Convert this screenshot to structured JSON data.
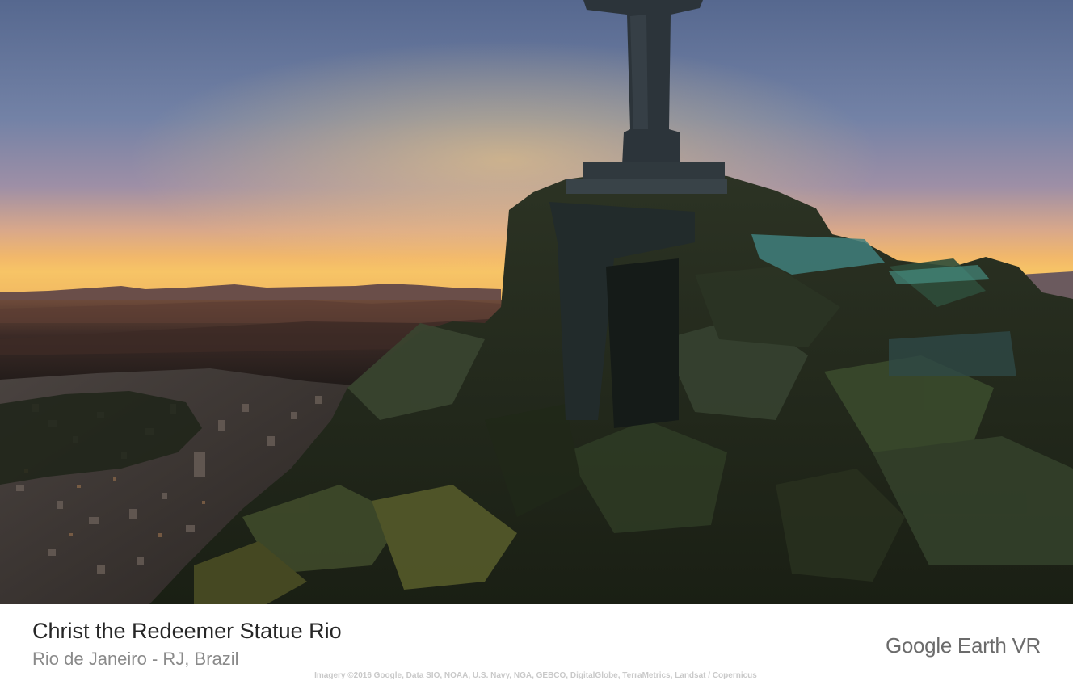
{
  "scene": {
    "image_subject": "christ-the-redeemer-summit",
    "sky_colors": [
      "#5a6e96",
      "#8a86a6",
      "#c9a3a3",
      "#e8b479",
      "#f6c569"
    ]
  },
  "location": {
    "title": "Christ the Redeemer Statue Rio",
    "subtitle": "Rio de Janeiro - RJ, Brazil"
  },
  "branding": {
    "label": "Google Earth VR"
  },
  "attribution": {
    "text": "Imagery ©2016 Google, Data SIO, NOAA, U.S. Navy, NGA, GEBCO, DigitalGlobe, TerraMetrics, Landsat / Copernicus"
  }
}
